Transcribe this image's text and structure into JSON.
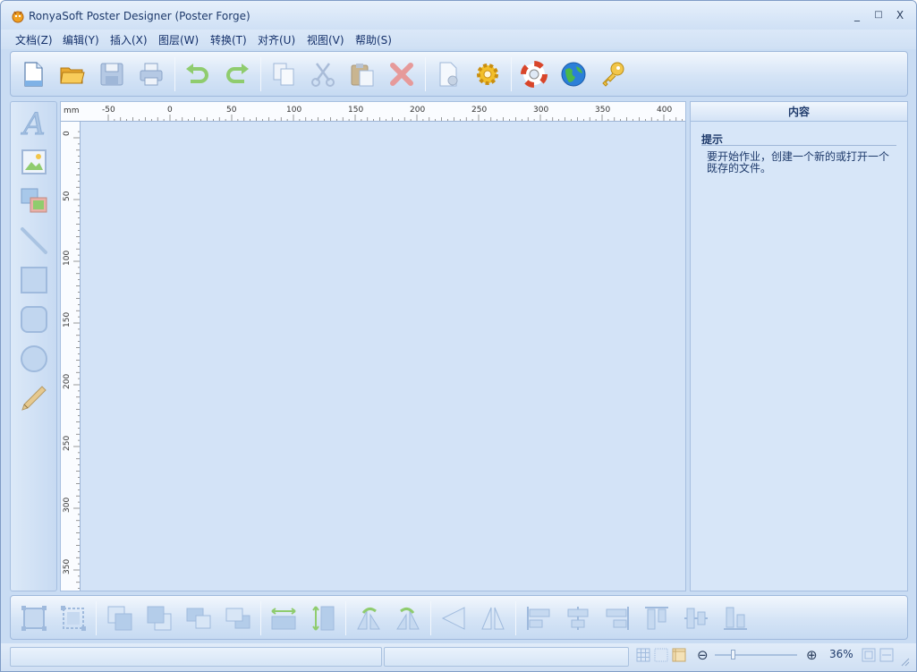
{
  "window": {
    "title": "RonyaSoft Poster Designer (Poster Forge)",
    "controls": {
      "minimize": "_",
      "maximize": "□",
      "close": "X"
    }
  },
  "menu": [
    "文档(Z)",
    "编辑(Y)",
    "插入(X)",
    "图层(W)",
    "转换(T)",
    "对齐(U)",
    "视图(V)",
    "帮助(S)"
  ],
  "toolbar": {
    "icons": [
      "new-document-icon",
      "open-folder-icon",
      "save-icon",
      "print-icon",
      "undo-icon",
      "redo-icon",
      "copy-icon",
      "cut-icon",
      "paste-icon",
      "delete-icon",
      "properties-icon",
      "settings-gear-icon",
      "help-lifebuoy-icon",
      "web-globe-icon",
      "register-key-icon"
    ]
  },
  "left_tools": [
    "text-tool-icon",
    "image-tool-icon",
    "layers-image-tool-icon",
    "line-tool-icon",
    "rectangle-tool-icon",
    "rounded-rectangle-tool-icon",
    "ellipse-tool-icon",
    "pencil-tool-icon"
  ],
  "ruler": {
    "unit": "mm",
    "top_labels": [
      "-50",
      "0",
      "50",
      "100",
      "150",
      "200",
      "250",
      "300",
      "350",
      "400"
    ],
    "left_labels": [
      "0",
      "50",
      "100",
      "150",
      "200",
      "250",
      "300",
      "350"
    ]
  },
  "panel": {
    "title": "内容",
    "hint_heading": "提示",
    "hint_text": "要开始作业，创建一个新的或打开一个既存的文件。"
  },
  "bottom_tools": [
    "group-icon",
    "ungroup-icon",
    "bring-to-front-icon",
    "send-to-back-icon",
    "bring-forward-icon",
    "send-backward-icon",
    "same-width-icon",
    "same-height-icon",
    "rotate-left-icon",
    "rotate-right-icon",
    "flip-horizontal-icon",
    "flip-vertical-icon",
    "align-left-icon",
    "align-center-icon",
    "align-right-icon",
    "align-top-icon",
    "align-middle-icon",
    "align-bottom-icon"
  ],
  "status": {
    "zoom": "36%",
    "zoom_out": "⊖",
    "zoom_in": "⊕"
  },
  "colors": {
    "frame": "#c9dcf3",
    "canvas": "#d3e3f7",
    "icon_disabled": "#a9c3e2"
  }
}
